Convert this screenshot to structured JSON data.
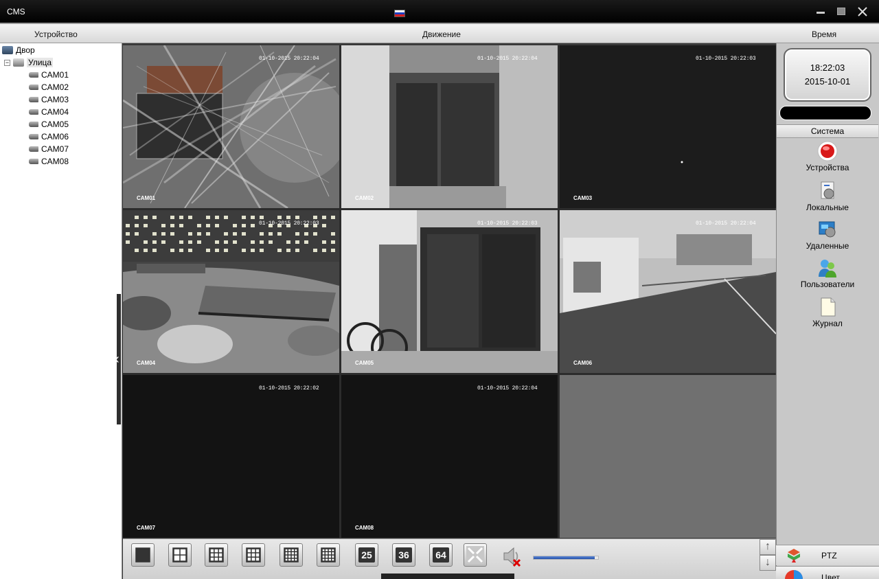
{
  "window": {
    "title": "CMS",
    "flag_colors": [
      "#ffffff",
      "#1f3fbf",
      "#d81e1e"
    ]
  },
  "menubar": {
    "device_label": "Устройство",
    "motion_label": "Движение",
    "time_label": "Время"
  },
  "tree": {
    "root_label": "Двор",
    "group_label": "Улица",
    "cameras": [
      "CAM01",
      "CAM02",
      "CAM03",
      "CAM04",
      "CAM05",
      "CAM06",
      "CAM07",
      "CAM08"
    ]
  },
  "tiles": [
    {
      "timestamp": "01-10-2015 20:22:04",
      "label": "CAM01",
      "scene": "glass",
      "selected": true
    },
    {
      "timestamp": "01-10-2015 20:22:04",
      "label": "CAM02",
      "scene": "door",
      "selected": false
    },
    {
      "timestamp": "01-10-2015 20:22:03",
      "label": "CAM03",
      "scene": "dark",
      "selected": false
    },
    {
      "timestamp": "01-10-2015 20:22:03",
      "label": "CAM04",
      "scene": "yard",
      "selected": false
    },
    {
      "timestamp": "01-10-2015 20:22:03",
      "label": "CAM05",
      "scene": "door2",
      "selected": false
    },
    {
      "timestamp": "01-10-2015 20:22:04",
      "label": "CAM06",
      "scene": "roof",
      "selected": false
    },
    {
      "timestamp": "01-10-2015 20:22:02",
      "label": "CAM07",
      "scene": "black",
      "selected": false
    },
    {
      "timestamp": "01-10-2015 20:22:04",
      "label": "CAM08",
      "scene": "black",
      "selected": false
    },
    {
      "timestamp": "",
      "label": "",
      "scene": "empty",
      "selected": false
    }
  ],
  "right_panel": {
    "clock_time": "18:22:03",
    "clock_date": "2015-10-01",
    "system_header": "Система",
    "items": [
      {
        "label": "Устройства",
        "icon": "record-icon"
      },
      {
        "label": "Локальные",
        "icon": "local-settings-icon"
      },
      {
        "label": "Удаленные",
        "icon": "remote-settings-icon"
      },
      {
        "label": "Пользователи",
        "icon": "users-icon"
      },
      {
        "label": "Журнал",
        "icon": "log-icon"
      }
    ],
    "ptz_label": "PTZ",
    "color_label": "Цвет"
  },
  "toolbar": {
    "layouts": [
      "1",
      "4",
      "6",
      "9",
      "12",
      "16",
      "25",
      "36",
      "64"
    ],
    "num_25": "25",
    "num_36": "36",
    "num_64": "64",
    "volume_level": 0.95,
    "accent_color": "#3bc43b"
  }
}
